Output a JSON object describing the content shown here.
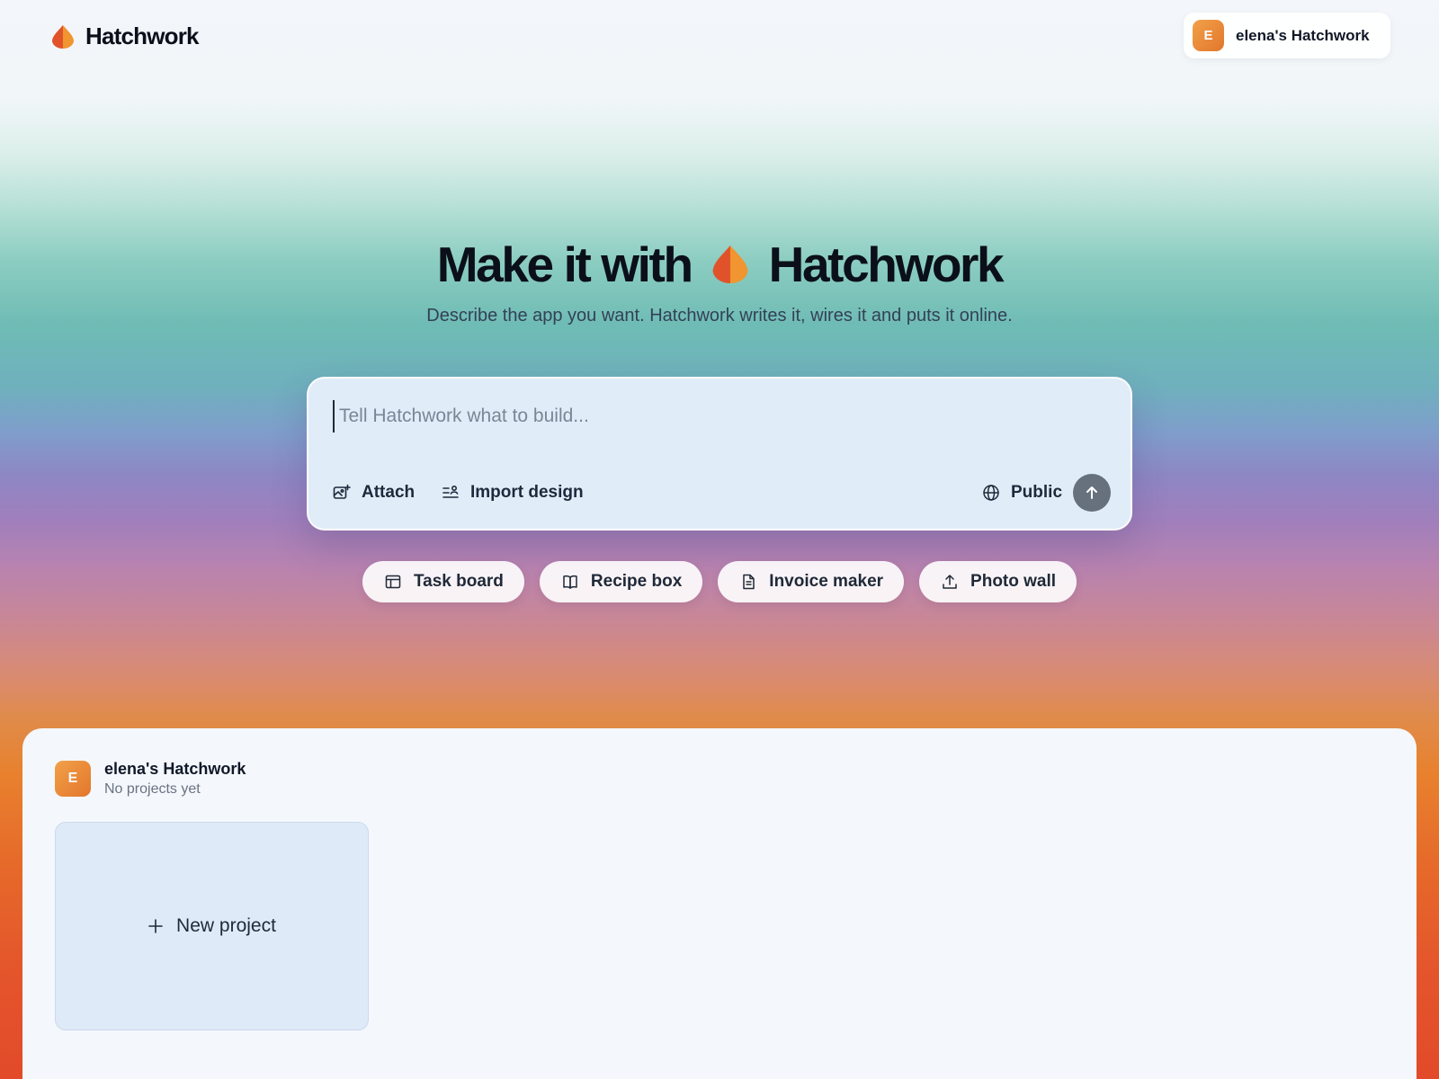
{
  "header": {
    "brand_name": "Hatchwork",
    "workspace": {
      "avatar_letter": "E",
      "label": "elena's Hatchwork"
    }
  },
  "hero": {
    "title_before": "Make it with",
    "title_brand": "Hatchwork",
    "subtitle": "Describe the app you want. Hatchwork writes it, wires it and puts it online."
  },
  "prompt": {
    "placeholder": "Tell Hatchwork what to build...",
    "value": "",
    "attach_label": "Attach",
    "import_label": "Import design",
    "visibility_label": "Public"
  },
  "suggestions": [
    {
      "label": "Task board",
      "icon": "table-icon"
    },
    {
      "label": "Recipe box",
      "icon": "book-icon"
    },
    {
      "label": "Invoice maker",
      "icon": "document-icon"
    },
    {
      "label": "Photo wall",
      "icon": "upload-icon"
    }
  ],
  "workspace_panel": {
    "avatar_letter": "E",
    "title": "elena's Hatchwork",
    "meta": "No projects yet",
    "new_project_label": "New project"
  },
  "colors": {
    "brand_orange": "#f0922f",
    "brand_red": "#e0532a",
    "send_button": "#66717d",
    "prompt_bg": "#e1ecf9"
  }
}
